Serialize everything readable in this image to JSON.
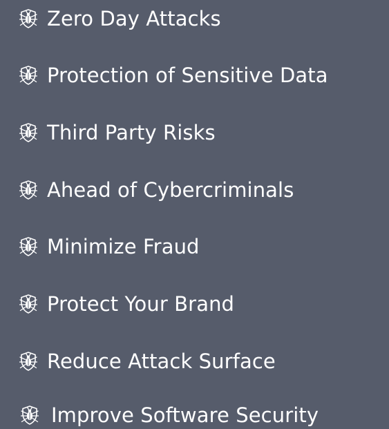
{
  "list": {
    "bullet_icon": "shield-bug-icon",
    "bullet_color": "#ffffff",
    "background_color": "#565c6b",
    "items": [
      {
        "label": "Zero Day Attacks"
      },
      {
        "label": "Protection of Sensitive Data"
      },
      {
        "label": "Third Party Risks"
      },
      {
        "label": "Ahead of Cybercriminals"
      },
      {
        "label": "Minimize Fraud"
      },
      {
        "label": "Protect Your Brand"
      },
      {
        "label": "Reduce Attack Surface"
      },
      {
        "label": "Improve Software Security"
      }
    ]
  }
}
